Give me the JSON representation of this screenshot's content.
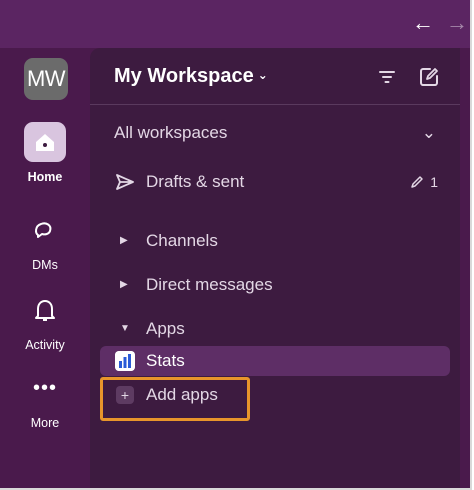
{
  "nav": {
    "back_icon": "arrow-left-icon",
    "forward_icon": "arrow-right-icon"
  },
  "rail": {
    "workspace_initials": "MW",
    "items": [
      {
        "label": "Home",
        "icon": "home-icon",
        "active": true
      },
      {
        "label": "DMs",
        "icon": "dm-bubbles-icon",
        "active": false
      },
      {
        "label": "Activity",
        "icon": "bell-icon",
        "active": false
      },
      {
        "label": "More",
        "icon": "more-dots-icon",
        "active": false
      }
    ]
  },
  "sidebar": {
    "workspace_name": "My Workspace",
    "all_workspaces": "All workspaces",
    "drafts": {
      "label": "Drafts & sent",
      "count": "1"
    },
    "sections": [
      {
        "label": "Channels",
        "expanded": false
      },
      {
        "label": "Direct messages",
        "expanded": false
      },
      {
        "label": "Apps",
        "expanded": true
      }
    ],
    "apps": [
      {
        "label": "Stats"
      }
    ],
    "add_apps": "Add apps"
  },
  "colors": {
    "frame": "#4a1a4c",
    "panel": "#3d1b40",
    "selected_row": "#5e2e66",
    "highlight_outline": "#e8952b"
  }
}
